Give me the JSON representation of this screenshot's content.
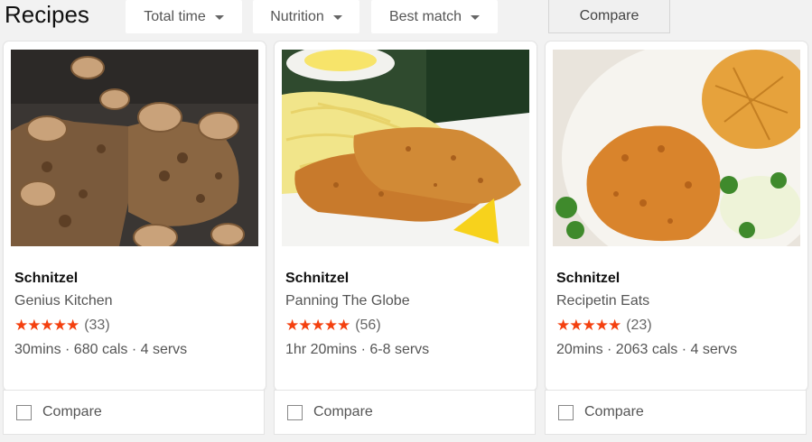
{
  "header": {
    "title": "Recipes",
    "filters": [
      {
        "label": "Total time"
      },
      {
        "label": "Nutrition"
      },
      {
        "label": "Best match"
      }
    ],
    "compare_label": "Compare"
  },
  "cards": [
    {
      "name": "Schnitzel",
      "source": "Genius Kitchen",
      "stars": "★★★★★",
      "reviews": "(33)",
      "meta": "30mins · 680 cals · 4 servs",
      "compare_label": "Compare"
    },
    {
      "name": "Schnitzel",
      "source": "Panning The Globe",
      "stars": "★★★★★",
      "reviews": "(56)",
      "meta": "1hr 20mins · 6-8 servs",
      "compare_label": "Compare"
    },
    {
      "name": "Schnitzel",
      "source": "Recipetin Eats",
      "stars": "★★★★★",
      "reviews": "(23)",
      "meta": "20mins · 2063 cals · 4 servs",
      "compare_label": "Compare"
    }
  ],
  "colors": {
    "star": "#f4400f",
    "background": "#f2f2f2",
    "card": "#ffffff"
  }
}
